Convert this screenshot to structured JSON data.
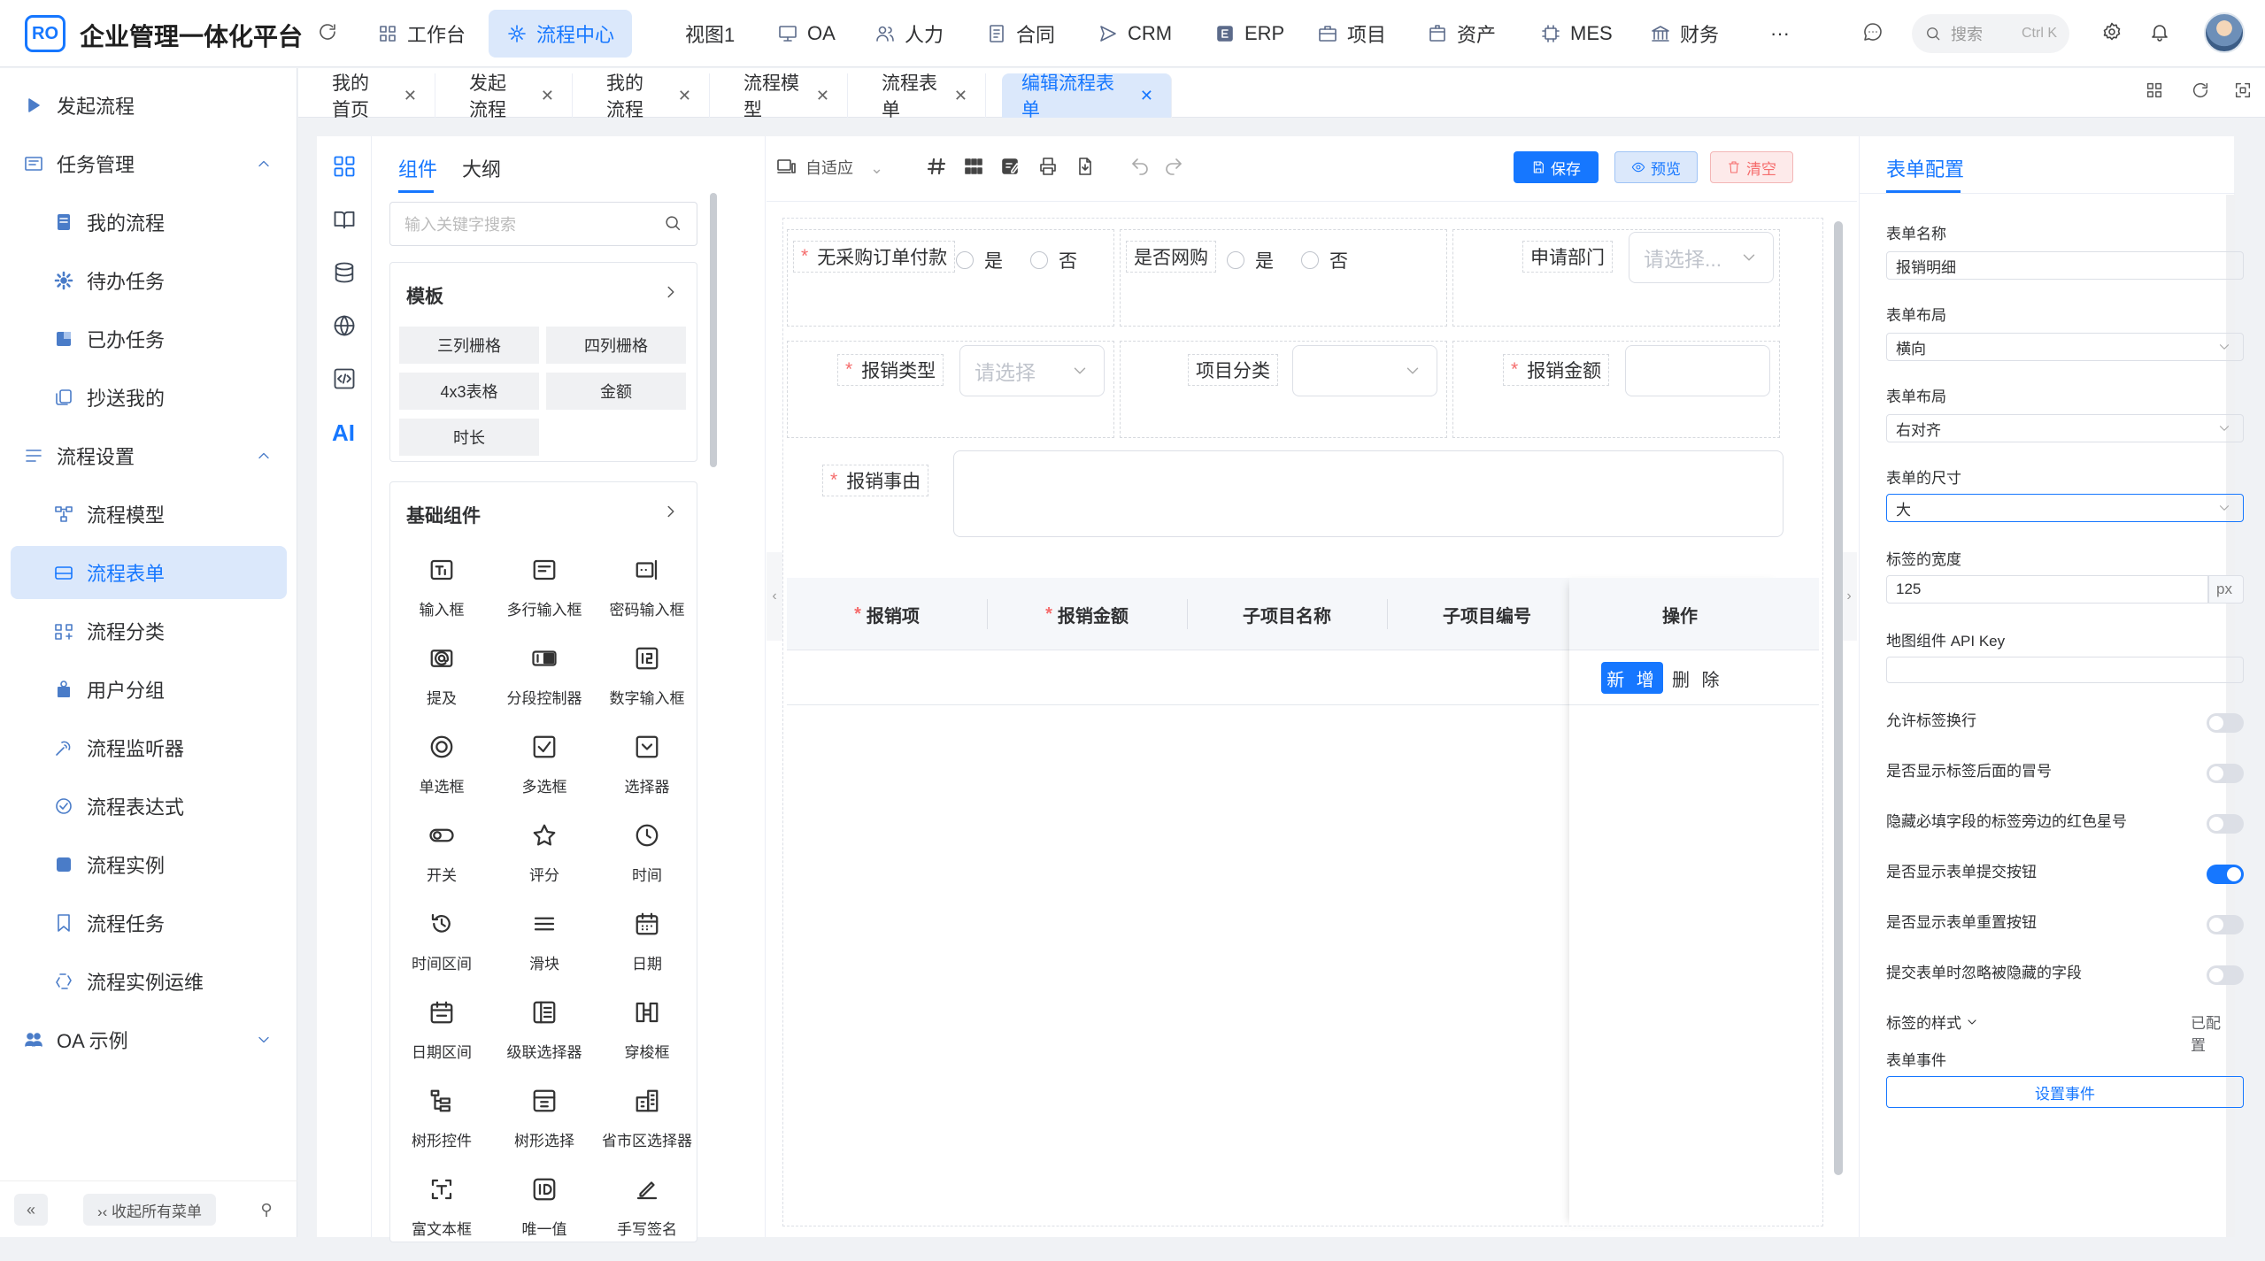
{
  "app": {
    "logo_text": "RO",
    "title": "企业管理一体化平台"
  },
  "topnav": [
    {
      "label": "工作台",
      "icon": "grid-icon"
    },
    {
      "label": "流程中心",
      "icon": "flow-icon",
      "active": true
    },
    {
      "label": "视图1",
      "icon": ""
    },
    {
      "label": "OA",
      "icon": "monitor-icon"
    },
    {
      "label": "人力",
      "icon": "people-icon"
    },
    {
      "label": "合同",
      "icon": "document-icon"
    },
    {
      "label": "CRM",
      "icon": "send-icon"
    },
    {
      "label": "ERP",
      "icon": "erp-icon"
    },
    {
      "label": "项目",
      "icon": "briefcase-icon"
    },
    {
      "label": "资产",
      "icon": "box-icon"
    },
    {
      "label": "MES",
      "icon": "chip-icon"
    },
    {
      "label": "财务",
      "icon": "bank-icon"
    },
    {
      "label": "···",
      "icon": ""
    }
  ],
  "search": {
    "placeholder": "搜索",
    "shortcut": "Ctrl K"
  },
  "sidebar": {
    "items": [
      {
        "label": "发起流程",
        "level": "top",
        "icon": "play-icon"
      },
      {
        "label": "任务管理",
        "level": "top",
        "icon": "task-icon",
        "expanded": true
      },
      {
        "label": "我的流程",
        "level": "sub",
        "icon": "book-icon"
      },
      {
        "label": "待办任务",
        "level": "sub",
        "icon": "cog-icon"
      },
      {
        "label": "已办任务",
        "level": "sub",
        "icon": "square-icon"
      },
      {
        "label": "抄送我的",
        "level": "sub",
        "icon": "copy-icon"
      },
      {
        "label": "流程设置",
        "level": "top",
        "icon": "list-icon",
        "expanded": true
      },
      {
        "label": "流程模型",
        "level": "sub",
        "icon": "model-icon"
      },
      {
        "label": "流程表单",
        "level": "sub",
        "icon": "form-icon",
        "active": true
      },
      {
        "label": "流程分类",
        "level": "sub",
        "icon": "category-icon"
      },
      {
        "label": "用户分组",
        "level": "sub",
        "icon": "user-group-icon"
      },
      {
        "label": "流程监听器",
        "level": "sub",
        "icon": "listener-icon"
      },
      {
        "label": "流程表达式",
        "level": "sub",
        "icon": "expression-icon"
      },
      {
        "label": "流程实例",
        "level": "sub",
        "icon": "instance-icon"
      },
      {
        "label": "流程任务",
        "level": "sub",
        "icon": "bookmark-icon"
      },
      {
        "label": "流程实例运维",
        "level": "sub",
        "icon": "recycle-icon"
      },
      {
        "label": "OA 示例",
        "level": "top",
        "icon": "oa-icon",
        "expanded": false
      }
    ],
    "footer": {
      "collapse_btn": "«",
      "collapse_all": "›‹ 收起所有菜单",
      "pin": "⚲"
    }
  },
  "tabs": [
    {
      "label": "我的首页"
    },
    {
      "label": "发起流程"
    },
    {
      "label": "我的流程"
    },
    {
      "label": "流程模型"
    },
    {
      "label": "流程表单"
    },
    {
      "label": "编辑流程表单",
      "active": true
    }
  ],
  "library": {
    "tab_components": "组件",
    "tab_outline": "大纲",
    "search_placeholder": "输入关键字搜索",
    "templates_title": "模板",
    "templates": [
      "三列栅格",
      "四列栅格",
      "4x3表格",
      "金额",
      "时长"
    ],
    "basic_title": "基础组件",
    "components": [
      {
        "label": "输入框",
        "icon": "input-icon"
      },
      {
        "label": "多行输入框",
        "icon": "textarea-icon"
      },
      {
        "label": "密码输入框",
        "icon": "password-icon"
      },
      {
        "label": "提及",
        "icon": "mention-icon"
      },
      {
        "label": "分段控制器",
        "icon": "segmented-icon"
      },
      {
        "label": "数字输入框",
        "icon": "number-icon"
      },
      {
        "label": "单选框",
        "icon": "radio-icon"
      },
      {
        "label": "多选框",
        "icon": "checkbox-icon"
      },
      {
        "label": "选择器",
        "icon": "select-icon"
      },
      {
        "label": "开关",
        "icon": "switch-icon"
      },
      {
        "label": "评分",
        "icon": "star-icon"
      },
      {
        "label": "时间",
        "icon": "clock-icon"
      },
      {
        "label": "时间区间",
        "icon": "time-range-icon"
      },
      {
        "label": "滑块",
        "icon": "slider-icon"
      },
      {
        "label": "日期",
        "icon": "calendar-icon"
      },
      {
        "label": "日期区间",
        "icon": "date-range-icon"
      },
      {
        "label": "级联选择器",
        "icon": "cascader-icon"
      },
      {
        "label": "穿梭框",
        "icon": "transfer-icon"
      },
      {
        "label": "树形控件",
        "icon": "tree-icon"
      },
      {
        "label": "树形选择",
        "icon": "tree-select-icon"
      },
      {
        "label": "省市区选择器",
        "icon": "region-icon"
      },
      {
        "label": "富文本框",
        "icon": "richtext-icon"
      },
      {
        "label": "唯一值",
        "icon": "id-icon"
      },
      {
        "label": "手写签名",
        "icon": "signature-icon"
      }
    ]
  },
  "toolbar": {
    "fit_label": "自适应",
    "save": "保存",
    "preview": "预览",
    "clear": "清空"
  },
  "form": {
    "row1": {
      "field1_label": "无采购订单付款",
      "opt_yes": "是",
      "opt_no": "否",
      "field2_label": "是否网购",
      "opt2_yes": "是",
      "opt2_no": "否",
      "field3_label": "申请部门",
      "field3_placeholder": "请选择..."
    },
    "row2": {
      "field1_label": "报销类型",
      "field1_placeholder": "请选择",
      "field2_label": "项目分类",
      "field3_label": "报销金额"
    },
    "row3": {
      "field_label": "报销事由"
    },
    "table": {
      "headers": [
        "报销项",
        "报销金额",
        "子项目名称",
        "子项目编号",
        "操作"
      ],
      "add": "新 增",
      "delete": "删 除"
    }
  },
  "config": {
    "tab": "表单配置",
    "form_name_label": "表单名称",
    "form_name": "报销明细",
    "layout_label": "表单布局",
    "layout": "横向",
    "align_label": "表单布局",
    "align": "右对齐",
    "size_label": "表单的尺寸",
    "size": "大",
    "label_width_label": "标签的宽度",
    "label_width": "125",
    "label_width_unit": "px",
    "map_key_label": "地图组件 API Key",
    "map_key": "",
    "switches": [
      {
        "label": "允许标签换行",
        "on": false
      },
      {
        "label": "是否显示标签后面的冒号",
        "on": false
      },
      {
        "label": "隐藏必填字段的标签旁边的红色星号",
        "on": false
      },
      {
        "label": "是否显示表单提交按钮",
        "on": true
      },
      {
        "label": "是否显示表单重置按钮",
        "on": false
      },
      {
        "label": "提交表单时忽略被隐藏的字段",
        "on": false
      }
    ],
    "label_style_label": "标签的样式",
    "label_style_value": "已配置",
    "events_label": "表单事件",
    "events_btn": "设置事件"
  },
  "colors": {
    "accent": "#1677ff",
    "danger": "#f56c6c",
    "active_bg": "#dbe8fb"
  }
}
